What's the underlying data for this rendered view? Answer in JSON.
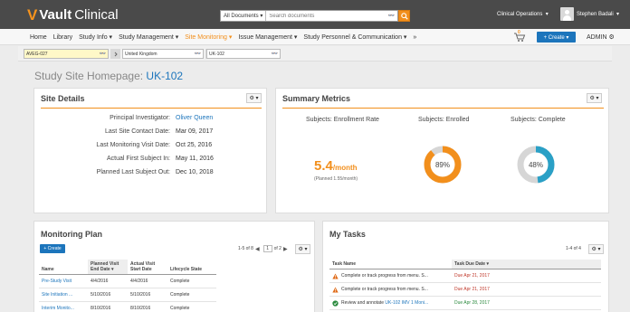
{
  "app": {
    "brand": "Vault",
    "product": "Clinical",
    "search_scope": "All Documents",
    "search_placeholder": "Search documents",
    "vault_selector": "Clinical Operations",
    "user_name": "Stephen Badali"
  },
  "nav": {
    "items": [
      {
        "label": "Home",
        "active": false
      },
      {
        "label": "Library",
        "active": false
      },
      {
        "label": "Study Info ▾",
        "active": false
      },
      {
        "label": "Study Management ▾",
        "active": false
      },
      {
        "label": "Site Monitoring ▾",
        "active": true
      },
      {
        "label": "Issue Management ▾",
        "active": false
      },
      {
        "label": "Study Personnel & Communication ▾",
        "active": false
      },
      {
        "label": "»",
        "active": false
      }
    ],
    "cart_count": "0",
    "create_label": "+ Create ▾",
    "admin_label": "ADMIN ⚙"
  },
  "context": {
    "study": "AVEG-027",
    "country": "United Kingdom",
    "site": "UK-102"
  },
  "page": {
    "title_prefix": "Study Site Homepage:",
    "site_code": "UK-102"
  },
  "site_details": {
    "title": "Site Details",
    "gear_label": "⚙ ▾",
    "rows": [
      {
        "label": "Principal Investigator:",
        "value": "Oliver Queen",
        "link": true
      },
      {
        "label": "Last Site Contact Date:",
        "value": "Mar 09, 2017",
        "link": false
      },
      {
        "label": "Last Monitoring Visit Date:",
        "value": "Oct 25, 2016",
        "link": false
      },
      {
        "label": "Actual First Subject In:",
        "value": "May 11, 2016",
        "link": false
      },
      {
        "label": "Planned Last Subject Out:",
        "value": "Dec 10, 2018",
        "link": false
      }
    ]
  },
  "summary_metrics": {
    "title": "Summary Metrics",
    "gear_label": "⚙ ▾",
    "enrollment_rate_label": "Subjects: Enrollment Rate",
    "enrollment_rate_value": "5.4",
    "enrollment_rate_unit": "/month",
    "enrollment_rate_planned": "(Planned 1.55/month)",
    "enrolled_label": "Subjects: Enrolled",
    "enrolled_percent": 89,
    "enrolled_text": "89%",
    "enrolled_color": "#f28f1c",
    "complete_label": "Subjects: Complete",
    "complete_percent": 48,
    "complete_text": "48%",
    "complete_color": "#2aa0c6",
    "track_color": "#d6d6d6"
  },
  "monitoring_plan": {
    "title": "Monitoring Plan",
    "create_label": "+ Create",
    "pager_range": "1-5 of 8",
    "pager_page": "1",
    "pager_total": "of 2",
    "gear_label": "⚙ ▾",
    "columns": [
      "Name",
      "Planned Visit End Date ▾",
      "Actual Visit Start Date",
      "Lifecycle State"
    ],
    "rows": [
      {
        "name": "Pre-Study Visit",
        "planned": "4/4/2016",
        "actual": "4/4/2016",
        "state": "Complete"
      },
      {
        "name": "Site Initiation ...",
        "planned": "5/10/2016",
        "actual": "5/10/2016",
        "state": "Complete"
      },
      {
        "name": "Interim Monito...",
        "planned": "8/10/2016",
        "actual": "8/10/2016",
        "state": "Complete"
      }
    ]
  },
  "my_tasks": {
    "title": "My Tasks",
    "pager_range": "1-4 of 4",
    "gear_label": "⚙ ▾",
    "columns": [
      "Task Name",
      "Task Due Date ▾"
    ],
    "rows": [
      {
        "icon": "warning",
        "text": "Complete or track progress from menu. S...",
        "link_text": "",
        "due": "Due Apr 21, 2017",
        "due_status": "overdue"
      },
      {
        "icon": "warning",
        "text": "Complete or track progress from menu. S...",
        "link_text": "",
        "due": "Due Apr 21, 2017",
        "due_status": "overdue"
      },
      {
        "icon": "ok",
        "text": "Review and annotate",
        "link_text": "UK-102 IMV 1 Moni...",
        "due": "Due Apr 28, 2017",
        "due_status": "upcoming"
      }
    ]
  }
}
